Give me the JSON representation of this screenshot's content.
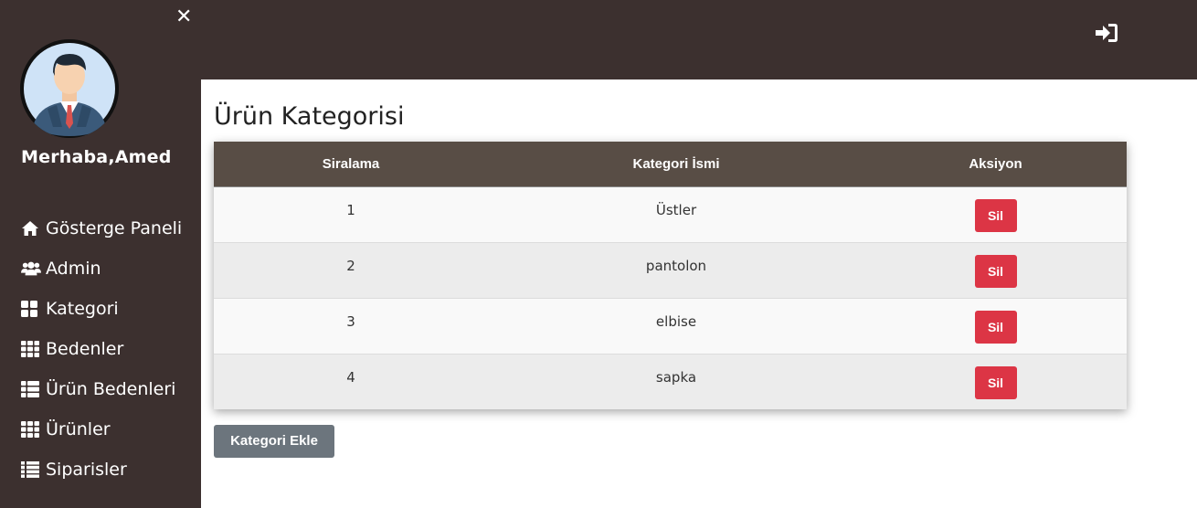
{
  "sidebar": {
    "greeting": "Merhaba,Amed",
    "items": [
      {
        "label": "Gösterge Paneli",
        "icon": "home-icon"
      },
      {
        "label": "Admin",
        "icon": "users-icon"
      },
      {
        "label": "Kategori",
        "icon": "th-large-icon"
      },
      {
        "label": "Bedenler",
        "icon": "th-icon"
      },
      {
        "label": "Ürün Bedenleri",
        "icon": "th-list-icon"
      },
      {
        "label": "Ürünler",
        "icon": "th-icon"
      },
      {
        "label": "Siparisler",
        "icon": "list-icon"
      }
    ]
  },
  "main": {
    "title": "Ürün Kategorisi",
    "table": {
      "headers": [
        "Siralama",
        "Kategori İsmi",
        "Aksiyon"
      ],
      "rows": [
        {
          "order": "1",
          "name": "Üstler",
          "action": "Sil"
        },
        {
          "order": "2",
          "name": "pantolon",
          "action": "Sil"
        },
        {
          "order": "3",
          "name": "elbise",
          "action": "Sil"
        },
        {
          "order": "4",
          "name": "sapka",
          "action": "Sil"
        }
      ]
    },
    "add_button": "Kategori Ekle"
  },
  "colors": {
    "sidebar_bg": "#3c302f",
    "table_header_bg": "#584d45",
    "danger": "#dc3545",
    "secondary": "#6c757d"
  }
}
